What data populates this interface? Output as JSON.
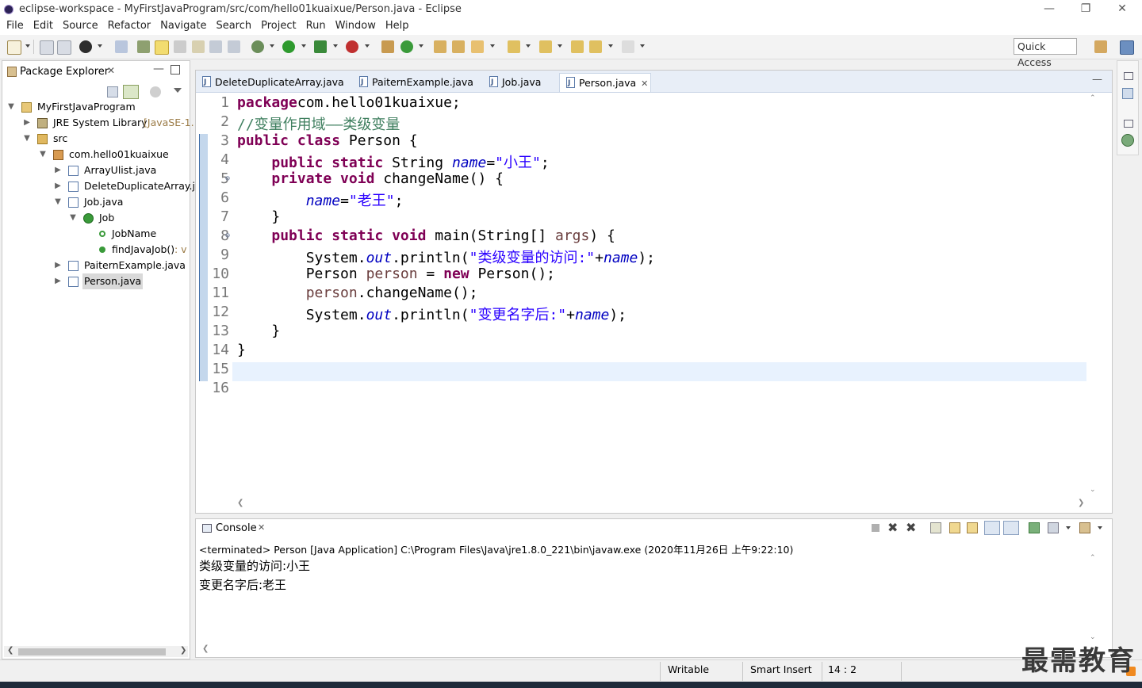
{
  "window": {
    "title": "eclipse-workspace - MyFirstJavaProgram/src/com/hello01kuaixue/Person.java - Eclipse"
  },
  "menu": [
    "File",
    "Edit",
    "Source",
    "Refactor",
    "Navigate",
    "Search",
    "Project",
    "Run",
    "Window",
    "Help"
  ],
  "toolbar": {
    "quick_access": "Quick Access"
  },
  "package_explorer": {
    "title": "Package Explorer",
    "tree": [
      {
        "label": "MyFirstJavaProgram",
        "decoration": "",
        "icon": "project-icon"
      },
      {
        "label": "JRE System Library",
        "decoration": "[JavaSE-1.",
        "icon": "library-icon"
      },
      {
        "label": "src",
        "decoration": "",
        "icon": "source-folder-icon"
      },
      {
        "label": "com.hello01kuaixue",
        "decoration": "",
        "icon": "package-icon"
      },
      {
        "label": "ArrayUlist.java",
        "decoration": "",
        "icon": "java-file-icon"
      },
      {
        "label": "DeleteDuplicateArray.ja",
        "decoration": "",
        "icon": "java-file-icon"
      },
      {
        "label": "Job.java",
        "decoration": "",
        "icon": "java-file-icon"
      },
      {
        "label": "Job",
        "decoration": "",
        "icon": "class-icon"
      },
      {
        "label": "JobName",
        "decoration": "",
        "icon": "field-icon"
      },
      {
        "label": "findJavaJob()",
        "decoration": ": v",
        "icon": "method-icon"
      },
      {
        "label": "PaiternExample.java",
        "decoration": "",
        "icon": "java-file-icon"
      },
      {
        "label": "Person.java",
        "decoration": "",
        "icon": "java-file-icon"
      }
    ]
  },
  "editor": {
    "tabs": [
      {
        "label": "DeleteDuplicateArray.java",
        "active": false
      },
      {
        "label": "PaiternExample.java",
        "active": false
      },
      {
        "label": "Job.java",
        "active": false
      },
      {
        "label": "Person.java",
        "active": true
      }
    ],
    "line_numbers": [
      "1",
      "2",
      "3",
      "4",
      "5",
      "6",
      "7",
      "8",
      "9",
      "10",
      "11",
      "12",
      "13",
      "14",
      "15",
      "16"
    ],
    "lines": [
      [
        [
          "kw",
          "package"
        ],
        [
          "",
          "com.hello01kuaixue;"
        ]
      ],
      [
        [
          "cm",
          "//变量作用域——类级变量"
        ]
      ],
      [
        [
          "kw",
          "public class"
        ],
        [
          "",
          " Person {"
        ]
      ],
      [
        [
          "",
          "    "
        ],
        [
          "kw",
          "public static"
        ],
        [
          "",
          " String "
        ],
        [
          "fld",
          "name"
        ],
        [
          "",
          "="
        ],
        [
          "str",
          "\"小王\""
        ],
        [
          "",
          ";"
        ]
      ],
      [
        [
          "",
          "    "
        ],
        [
          "kw",
          "private void"
        ],
        [
          "",
          " changeName() {"
        ]
      ],
      [
        [
          "",
          "        "
        ],
        [
          "fld",
          "name"
        ],
        [
          "",
          "="
        ],
        [
          "str",
          "\"老王\""
        ],
        [
          "",
          ";"
        ]
      ],
      [
        [
          "",
          "    }"
        ]
      ],
      [
        [
          "",
          "    "
        ],
        [
          "kw",
          "public static void"
        ],
        [
          "",
          " main(String[] "
        ],
        [
          "lv",
          "args"
        ],
        [
          "",
          ") {"
        ]
      ],
      [
        [
          "",
          "        System."
        ],
        [
          "fld",
          "out"
        ],
        [
          "",
          ".println("
        ],
        [
          "str",
          "\"类级变量的访问:\""
        ],
        [
          "",
          "+"
        ],
        [
          "fld",
          "name"
        ],
        [
          "",
          ");"
        ]
      ],
      [
        [
          "",
          "        Person "
        ],
        [
          "lv",
          "person"
        ],
        [
          "",
          " = "
        ],
        [
          "kw",
          "new"
        ],
        [
          "",
          " Person();"
        ]
      ],
      [
        [
          "",
          "        "
        ],
        [
          "lv",
          "person"
        ],
        [
          "",
          ".changeName();"
        ]
      ],
      [
        [
          "",
          "        System."
        ],
        [
          "fld",
          "out"
        ],
        [
          "",
          ".println("
        ],
        [
          "str",
          "\"变更名字后:\""
        ],
        [
          "",
          "+"
        ],
        [
          "fld",
          "name"
        ],
        [
          "",
          ");"
        ]
      ],
      [
        [
          "",
          "    }"
        ]
      ],
      [
        [
          "",
          "}"
        ]
      ],
      [],
      []
    ]
  },
  "console": {
    "title": "Console",
    "terminated": "<terminated> Person [Java Application] C:\\Program Files\\Java\\jre1.8.0_221\\bin\\javaw.exe (2020年11月26日 上午9:22:10)",
    "output": [
      "类级变量的访问:小王",
      "变更名字后:老王"
    ]
  },
  "status": {
    "writable": "Writable",
    "insert_mode": "Smart Insert",
    "position": "14 : 2"
  },
  "watermark": "最需教育",
  "colors": {
    "keyword": "#7f0055",
    "string": "#2a00ff",
    "comment": "#3f7f5f",
    "field": "#0000c0",
    "local_var": "#6a3e3e"
  }
}
